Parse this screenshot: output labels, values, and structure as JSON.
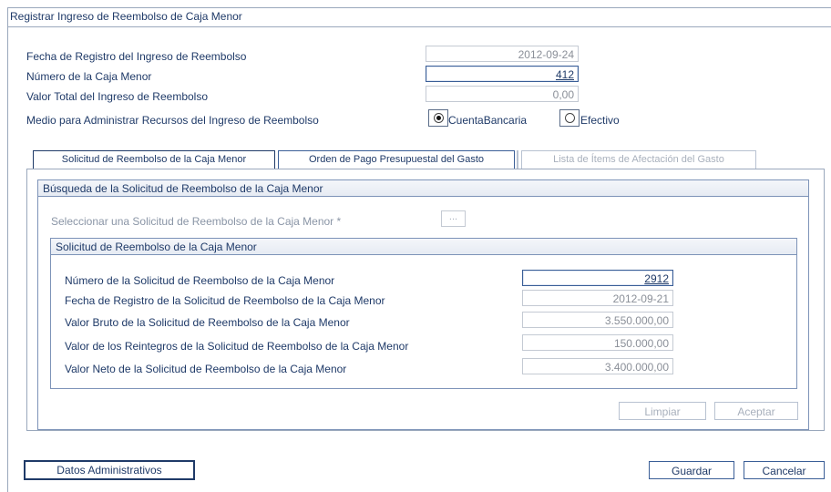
{
  "window": {
    "title": "Registrar Ingreso de Reembolso de Caja Menor"
  },
  "form": {
    "fecha_label": "Fecha de Registro del Ingreso de Reembolso",
    "fecha_value": "2012-09-24",
    "numero_label": "Número de la Caja Menor",
    "numero_value": "412",
    "valor_label": "Valor Total del Ingreso de Reembolso",
    "valor_value": "0,00",
    "medio_label": "Medio para Administrar Recursos del Ingreso de Reembolso",
    "medio_options": [
      {
        "label": "CuentaBancaria",
        "checked": true
      },
      {
        "label": "Efectivo",
        "checked": false
      }
    ]
  },
  "tabs": [
    {
      "label": "Solicitud de Reembolso de la Caja Menor",
      "state": "active"
    },
    {
      "label": "Orden de Pago Presupuestal del Gasto",
      "state": "enabled"
    },
    {
      "label": "Lista de Ítems de Afectación del Gasto",
      "state": "disabled"
    }
  ],
  "busqueda": {
    "header": "Búsqueda de la Solicitud de Reembolso de la Caja Menor",
    "select_label": "Seleccionar una Solicitud de Reembolso de la Caja Menor *",
    "ellipsis_label": "...",
    "solicitud": {
      "header": "Solicitud de Reembolso de la Caja Menor",
      "rows": [
        {
          "label": "Número de la Solicitud de Reembolso de la Caja Menor",
          "value": "2912"
        },
        {
          "label": "Fecha de Registro de la Solicitud de Reembolso de la Caja Menor",
          "value": "2012-09-21"
        },
        {
          "label": "Valor Bruto de la Solicitud de Reembolso de la Caja Menor",
          "value": "3.550.000,00"
        },
        {
          "label": "Valor de los Reintegros de la Solicitud de Reembolso de la Caja Menor",
          "value": "150.000,00"
        },
        {
          "label": "Valor Neto de la Solicitud de Reembolso de la Caja Menor",
          "value": "3.400.000,00"
        }
      ]
    },
    "limpiar_label": "Limpiar",
    "aceptar_label": "Aceptar"
  },
  "footer": {
    "datos_label": "Datos Administrativos",
    "guardar_label": "Guardar",
    "cancelar_label": "Cancelar"
  }
}
